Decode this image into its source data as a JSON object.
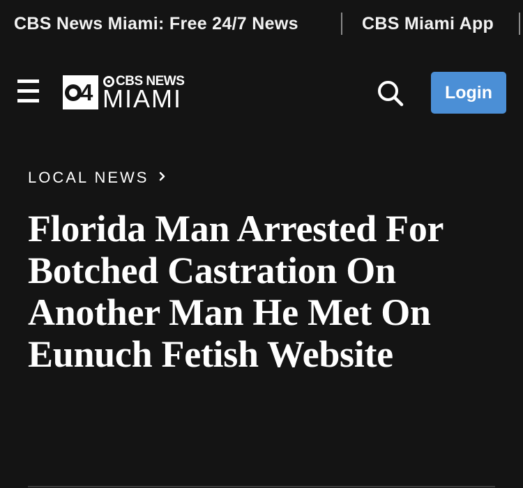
{
  "promo_bar": {
    "links": [
      "CBS News Miami: Free 24/7 News",
      "CBS Miami App"
    ]
  },
  "header": {
    "logo": {
      "badge_number": "4",
      "brand": "CBS NEWS",
      "city": "MIAMI"
    },
    "menu_icon": "hamburger-menu-icon",
    "search_icon": "search-icon",
    "login_label": "Login"
  },
  "article": {
    "breadcrumb": "LOCAL NEWS",
    "breadcrumb_icon": "chevron-right-icon",
    "headline": "Florida Man Arrested For Botched Castration On Another Man He Met On Eunuch Fetish Website"
  },
  "colors": {
    "background": "#141414",
    "text": "#ffffff",
    "accent": "#4b8fd6"
  }
}
